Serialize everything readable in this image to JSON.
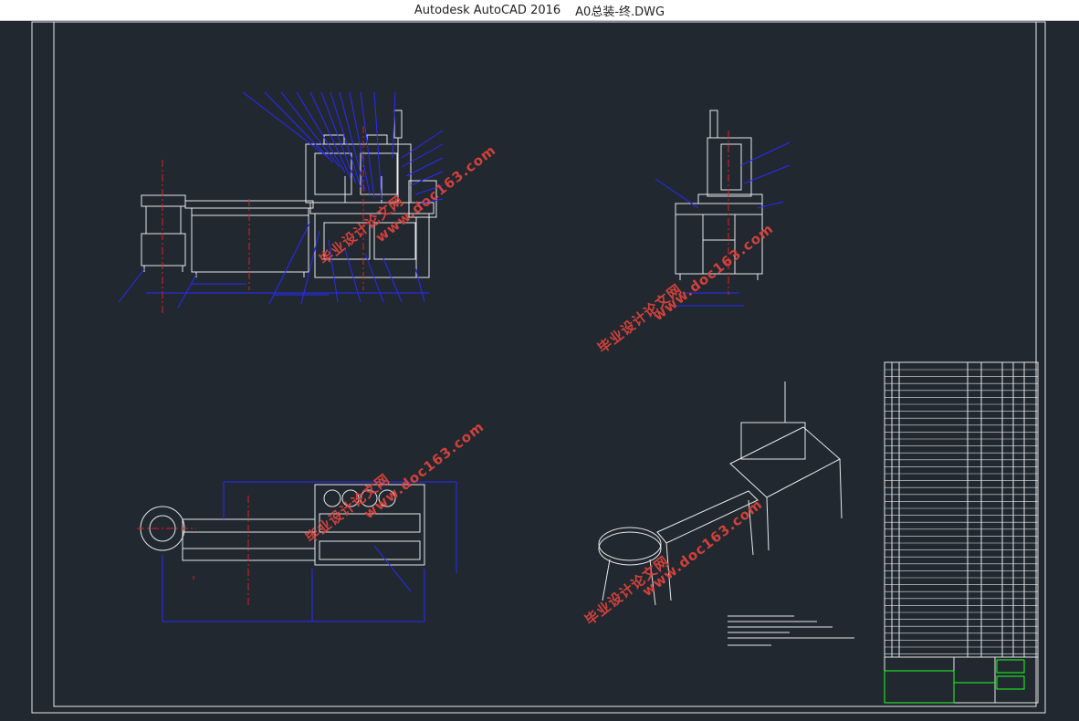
{
  "window": {
    "app_title": "Autodesk AutoCAD 2016",
    "file_name": "A0总装-终.DWG"
  },
  "watermarks": [
    {
      "text": "毕业设计论文网"
    },
    {
      "text": "www.doc163.com"
    }
  ],
  "colors": {
    "background": "#212830",
    "line_white": "#e8e8e8",
    "line_blue": "#2a2aff",
    "line_red": "#e02020",
    "line_green": "#20ff20",
    "watermark": "#e0443c"
  }
}
